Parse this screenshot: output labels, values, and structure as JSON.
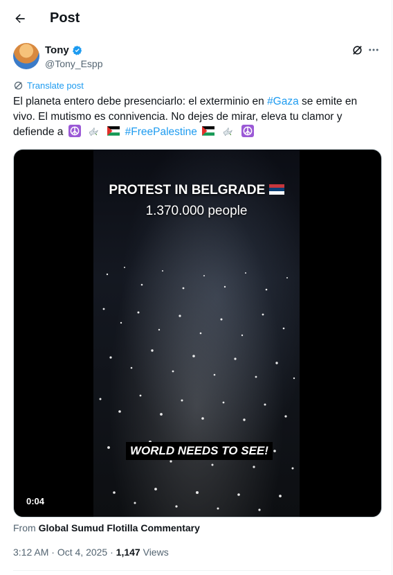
{
  "header": {
    "title": "Post"
  },
  "author": {
    "name": "Tony",
    "handle": "@Tony_Espp"
  },
  "translate": {
    "label": "Translate post"
  },
  "post": {
    "text_part1": "El planeta entero debe presenciarlo: el exterminio en ",
    "hashtag1": "#Gaza",
    "text_part2": " se emite en vivo. El mutismo es connivencia. No dejes de mirar, eleva tu clamor y defiende a ",
    "hashtag2": "#FreePalestine"
  },
  "media": {
    "overlay_title": "PROTEST IN BELGRADE",
    "overlay_subtitle": "1.370.000 people",
    "overlay_bottom": "WORLD NEEDS TO SEE!",
    "timestamp": "0:04"
  },
  "source": {
    "prefix": "From ",
    "name": "Global Sumud Flotilla Commentary"
  },
  "meta": {
    "time": "3:12 AM",
    "separator": " · ",
    "date": "Oct 4, 2025",
    "views_count": "1,147",
    "views_label": "Views"
  },
  "colors": {
    "accent": "#1d9bf0",
    "text": "#0f1419",
    "muted": "#536471"
  },
  "icons": {
    "back": "arrow-left-icon",
    "verified": "verified-badge-icon",
    "grok": "grok-icon",
    "more": "more-horizontal-icon",
    "translate": "translate-icon",
    "peace": "peace-symbol-icon",
    "dove": "dove-icon",
    "flag": "palestine-flag-icon"
  }
}
